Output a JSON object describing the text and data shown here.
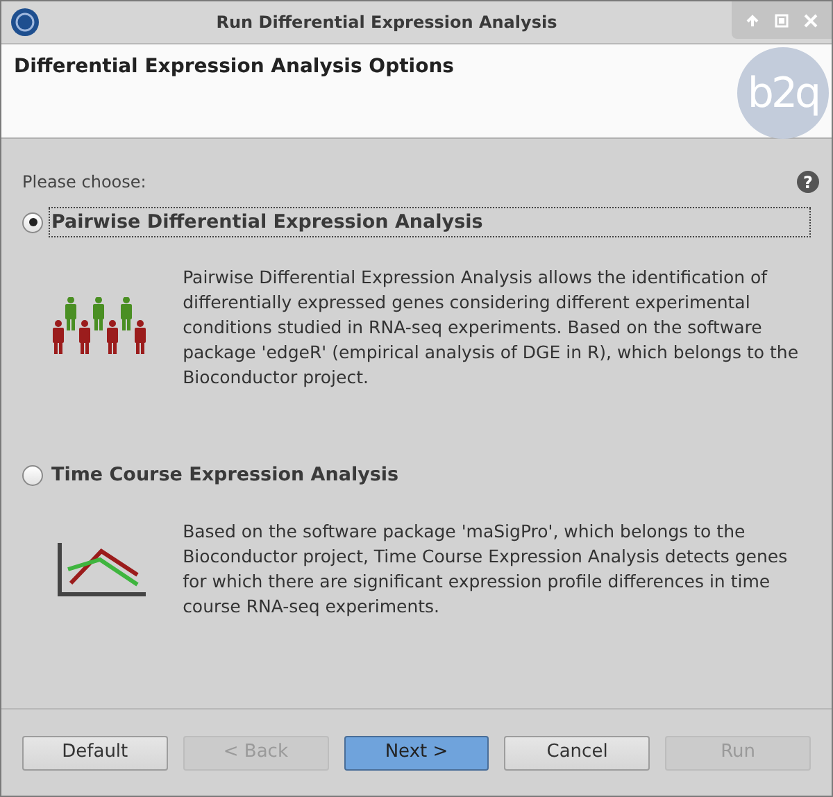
{
  "window": {
    "title": "Run Differential Expression Analysis"
  },
  "header": {
    "title": "Differential Expression Analysis Options",
    "logo_text": "b2q"
  },
  "prompt": "Please choose:",
  "help_label": "?",
  "options": [
    {
      "label": "Pairwise Differential Expression Analysis",
      "selected": true,
      "kind": "people",
      "description": "Pairwise Differential Expression Analysis allows the identification of differentially expressed genes considering different experimental conditions studied in RNA-seq experiments. Based on the software package 'edgeR' (empirical analysis of DGE in R), which belongs to the Bioconductor project."
    },
    {
      "label": "Time Course Expression Analysis",
      "selected": false,
      "kind": "chart",
      "description": "Based on the software package 'maSigPro', which belongs to the Bioconductor project, Time Course Expression Analysis detects genes for which there are significant expression profile differences in time course RNA-seq experiments."
    }
  ],
  "buttons": [
    {
      "label": "Default",
      "disabled": false,
      "highlighted": false
    },
    {
      "label": "< Back",
      "disabled": true,
      "highlighted": false
    },
    {
      "label": "Next >",
      "disabled": false,
      "highlighted": true
    },
    {
      "label": "Cancel",
      "disabled": false,
      "highlighted": false
    },
    {
      "label": "Run",
      "disabled": true,
      "highlighted": false
    }
  ]
}
